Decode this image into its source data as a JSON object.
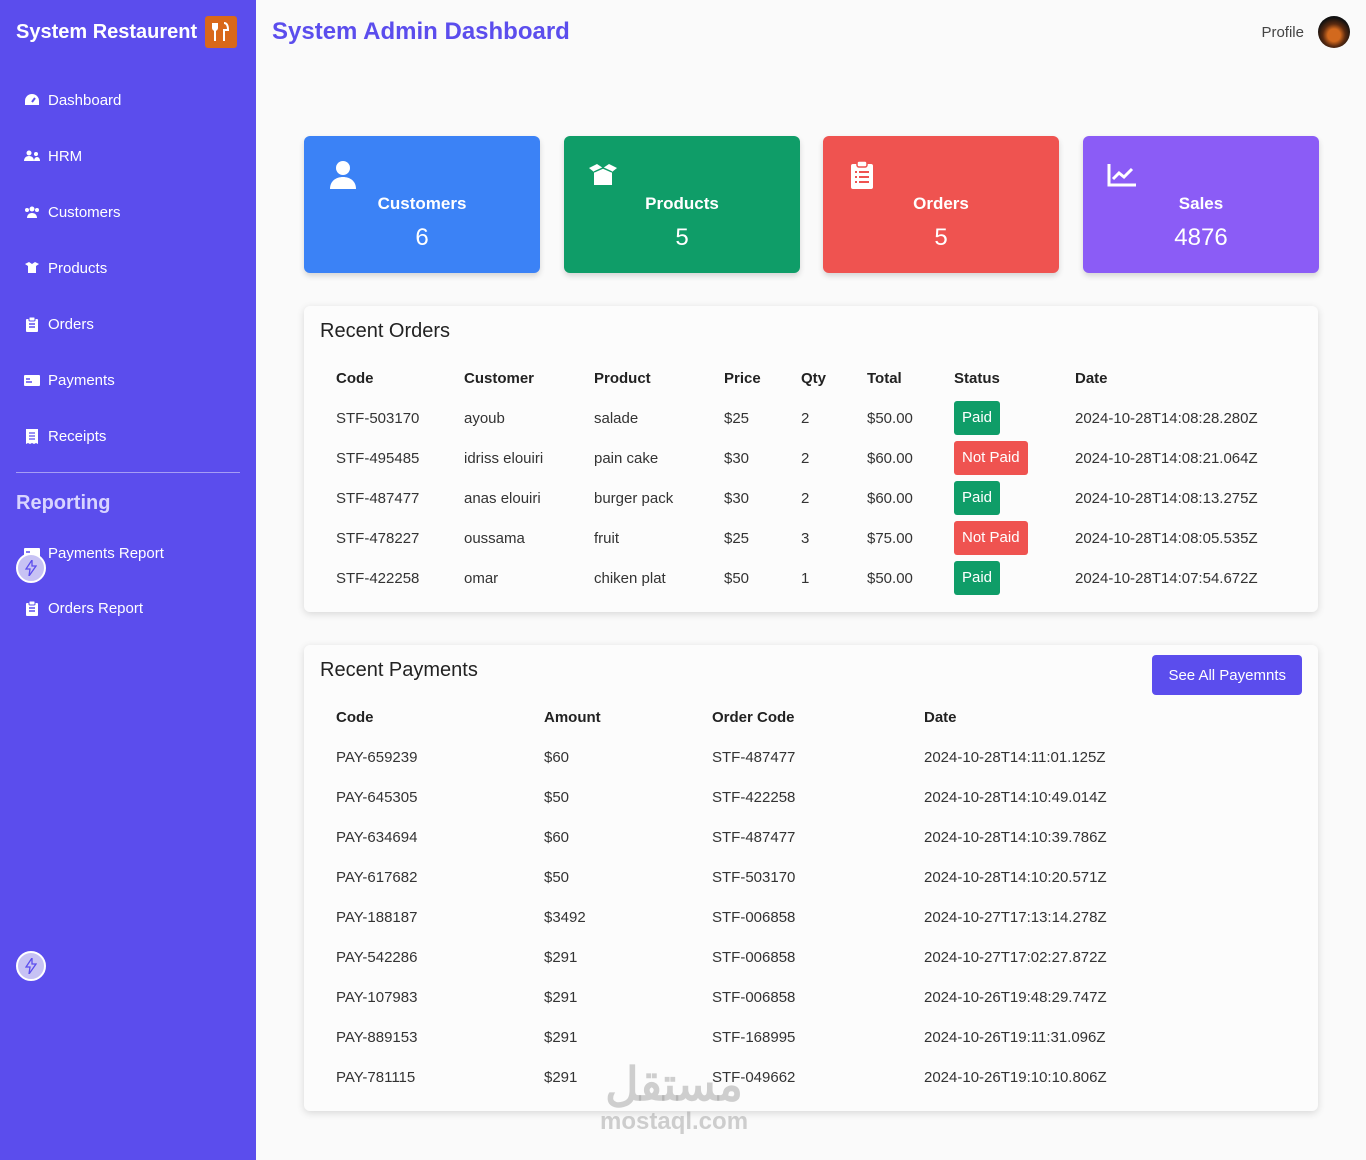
{
  "app": {
    "title": "System Restaurent",
    "logo_icon": "fork-knife-icon"
  },
  "sidebar": {
    "items": [
      {
        "label": "Dashboard",
        "icon": "gauge-icon"
      },
      {
        "label": "HRM",
        "icon": "users-icon"
      },
      {
        "label": "Customers",
        "icon": "user-group-icon"
      },
      {
        "label": "Products",
        "icon": "box-icon"
      },
      {
        "label": "Orders",
        "icon": "clipboard-icon"
      },
      {
        "label": "Payments",
        "icon": "card-icon"
      },
      {
        "label": "Receipts",
        "icon": "receipt-icon"
      }
    ],
    "section_title": "Reporting",
    "report_items": [
      {
        "label": "Payments Report",
        "icon": "card-icon"
      },
      {
        "label": "Orders Report",
        "icon": "clipboard-icon"
      }
    ]
  },
  "header": {
    "title": "System Admin Dashboard",
    "profile_label": "Profile"
  },
  "stats": [
    {
      "label": "Customers",
      "value": "6",
      "color": "#3b82f6",
      "icon": "user-icon"
    },
    {
      "label": "Products",
      "value": "5",
      "color": "#0f9d68",
      "icon": "box-icon"
    },
    {
      "label": "Orders",
      "value": "5",
      "color": "#ef5350",
      "icon": "clipboard-list-icon"
    },
    {
      "label": "Sales",
      "value": "4876",
      "color": "#8b5cf6",
      "icon": "chart-line-icon"
    }
  ],
  "recent_orders": {
    "title": "Recent Orders",
    "columns": [
      "Code",
      "Customer",
      "Product",
      "Price",
      "Qty",
      "Total",
      "Status",
      "Date"
    ],
    "rows": [
      [
        "STF-503170",
        "ayoub",
        "salade",
        "$25",
        "2",
        "$50.00",
        "Paid",
        "2024-10-28T14:08:28.280Z"
      ],
      [
        "STF-495485",
        "idriss elouiri",
        "pain cake",
        "$30",
        "2",
        "$60.00",
        "Not Paid",
        "2024-10-28T14:08:21.064Z"
      ],
      [
        "STF-487477",
        "anas elouiri",
        "burger pack",
        "$30",
        "2",
        "$60.00",
        "Paid",
        "2024-10-28T14:08:13.275Z"
      ],
      [
        "STF-478227",
        "oussama",
        "fruit",
        "$25",
        "3",
        "$75.00",
        "Not Paid",
        "2024-10-28T14:08:05.535Z"
      ],
      [
        "STF-422258",
        "omar",
        "chiken plat",
        "$50",
        "1",
        "$50.00",
        "Paid",
        "2024-10-28T14:07:54.672Z"
      ]
    ]
  },
  "recent_payments": {
    "title": "Recent Payments",
    "button_label": "See All Payemnts",
    "columns": [
      "Code",
      "Amount",
      "Order Code",
      "Date"
    ],
    "rows": [
      [
        "PAY-659239",
        "$60",
        "STF-487477",
        "2024-10-28T14:11:01.125Z"
      ],
      [
        "PAY-645305",
        "$50",
        "STF-422258",
        "2024-10-28T14:10:49.014Z"
      ],
      [
        "PAY-634694",
        "$60",
        "STF-487477",
        "2024-10-28T14:10:39.786Z"
      ],
      [
        "PAY-617682",
        "$50",
        "STF-503170",
        "2024-10-28T14:10:20.571Z"
      ],
      [
        "PAY-188187",
        "$3492",
        "STF-006858",
        "2024-10-27T17:13:14.278Z"
      ],
      [
        "PAY-542286",
        "$291",
        "STF-006858",
        "2024-10-27T17:02:27.872Z"
      ],
      [
        "PAY-107983",
        "$291",
        "STF-006858",
        "2024-10-26T19:48:29.747Z"
      ],
      [
        "PAY-889153",
        "$291",
        "STF-168995",
        "2024-10-26T19:11:31.096Z"
      ],
      [
        "PAY-781115",
        "$291",
        "STF-049662",
        "2024-10-26T19:10:10.806Z"
      ]
    ]
  },
  "watermark": {
    "arabic": "مستقل",
    "latin": "mostaql.com"
  }
}
